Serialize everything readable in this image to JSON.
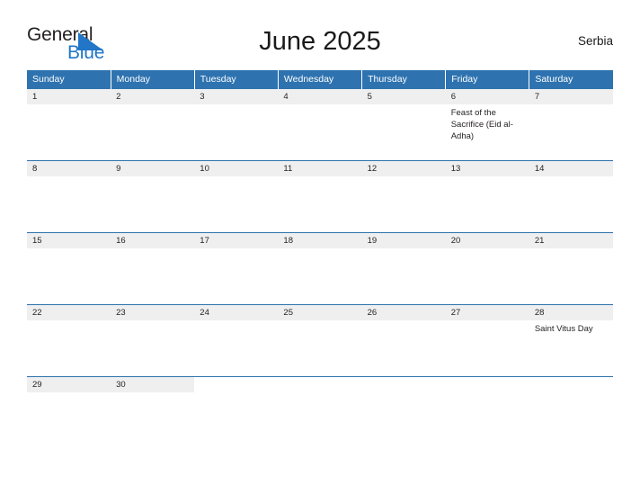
{
  "brand": {
    "name_part1": "General",
    "name_part2": "Blue",
    "accent_color": "#2176c7",
    "flag_icon": "blue-flag-triangle-icon"
  },
  "header": {
    "title": "June 2025",
    "region": "Serbia"
  },
  "calendar": {
    "header_bg_color": "#2e73b0",
    "daynum_bg_color": "#efefef",
    "weekday_names": [
      "Sunday",
      "Monday",
      "Tuesday",
      "Wednesday",
      "Thursday",
      "Friday",
      "Saturday"
    ],
    "weeks": [
      [
        {
          "day": "1",
          "events": []
        },
        {
          "day": "2",
          "events": []
        },
        {
          "day": "3",
          "events": []
        },
        {
          "day": "4",
          "events": []
        },
        {
          "day": "5",
          "events": []
        },
        {
          "day": "6",
          "events": [
            "Feast of the Sacrifice (Eid al-Adha)"
          ]
        },
        {
          "day": "7",
          "events": []
        }
      ],
      [
        {
          "day": "8",
          "events": []
        },
        {
          "day": "9",
          "events": []
        },
        {
          "day": "10",
          "events": []
        },
        {
          "day": "11",
          "events": []
        },
        {
          "day": "12",
          "events": []
        },
        {
          "day": "13",
          "events": []
        },
        {
          "day": "14",
          "events": []
        }
      ],
      [
        {
          "day": "15",
          "events": []
        },
        {
          "day": "16",
          "events": []
        },
        {
          "day": "17",
          "events": []
        },
        {
          "day": "18",
          "events": []
        },
        {
          "day": "19",
          "events": []
        },
        {
          "day": "20",
          "events": []
        },
        {
          "day": "21",
          "events": []
        }
      ],
      [
        {
          "day": "22",
          "events": []
        },
        {
          "day": "23",
          "events": []
        },
        {
          "day": "24",
          "events": []
        },
        {
          "day": "25",
          "events": []
        },
        {
          "day": "26",
          "events": []
        },
        {
          "day": "27",
          "events": []
        },
        {
          "day": "28",
          "events": [
            "Saint Vitus Day"
          ]
        }
      ],
      [
        {
          "day": "29",
          "events": []
        },
        {
          "day": "30",
          "events": []
        },
        {
          "day": "",
          "events": []
        },
        {
          "day": "",
          "events": []
        },
        {
          "day": "",
          "events": []
        },
        {
          "day": "",
          "events": []
        },
        {
          "day": "",
          "events": []
        }
      ]
    ]
  }
}
